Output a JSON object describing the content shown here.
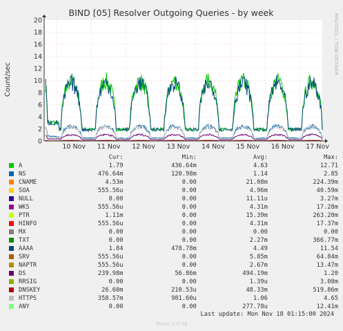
{
  "chart_data": {
    "type": "line",
    "title": "BIND [05] Resolver Outgoing Queries - by week",
    "ylabel": "Count/sec",
    "side_label": "RRDTOOL / TOBI OETIKER",
    "ylim": [
      0,
      20
    ],
    "y_ticks": [
      "0",
      "2",
      "4",
      "6",
      "8",
      "10",
      "12",
      "14",
      "16",
      "18",
      "20"
    ],
    "x_ticks": [
      "10 Nov",
      "11 Nov",
      "12 Nov",
      "13 Nov",
      "14 Nov",
      "15 Nov",
      "16 Nov",
      "17 Nov"
    ],
    "grid": true,
    "headers": [
      "Cur:",
      "Min:",
      "Avg:",
      "Max:"
    ],
    "series": [
      {
        "name": "A",
        "color": "#00cc00",
        "cur": "1.79",
        "min": "436.64m",
        "avg": "4.63",
        "max": "12.71"
      },
      {
        "name": "NS",
        "color": "#0066b3",
        "cur": "476.64m",
        "min": "120.98m",
        "avg": "1.14",
        "max": "2.85"
      },
      {
        "name": "CNAME",
        "color": "#ff8000",
        "cur": "4.53m",
        "min": "0.00",
        "avg": "21.08m",
        "max": "224.39m"
      },
      {
        "name": "SOA",
        "color": "#ffcc00",
        "cur": "555.56u",
        "min": "0.00",
        "avg": "4.96m",
        "max": "40.59m"
      },
      {
        "name": "NULL",
        "color": "#330099",
        "cur": "0.00",
        "min": "0.00",
        "avg": "11.11u",
        "max": "3.27m"
      },
      {
        "name": "WKS",
        "color": "#990099",
        "cur": "555.56u",
        "min": "0.00",
        "avg": "4.31m",
        "max": "17.28m"
      },
      {
        "name": "PTR",
        "color": "#ccff00",
        "cur": "1.11m",
        "min": "0.00",
        "avg": "15.39m",
        "max": "263.20m"
      },
      {
        "name": "HINFO",
        "color": "#ff0000",
        "cur": "555.56u",
        "min": "0.00",
        "avg": "4.31m",
        "max": "17.37m"
      },
      {
        "name": "MX",
        "color": "#808080",
        "cur": "0.00",
        "min": "0.00",
        "avg": "0.00",
        "max": "0.00"
      },
      {
        "name": "TXT",
        "color": "#008f00",
        "cur": "0.00",
        "min": "0.00",
        "avg": "2.27m",
        "max": "366.77m"
      },
      {
        "name": "AAAA",
        "color": "#00487d",
        "cur": "1.84",
        "min": "478.78m",
        "avg": "4.49",
        "max": "11.54"
      },
      {
        "name": "SRV",
        "color": "#b35a00",
        "cur": "555.56u",
        "min": "0.00",
        "avg": "5.85m",
        "max": "64.84m"
      },
      {
        "name": "NAPTR",
        "color": "#b38f00",
        "cur": "555.56u",
        "min": "0.00",
        "avg": "2.67m",
        "max": "13.47m"
      },
      {
        "name": "DS",
        "color": "#6b006b",
        "cur": "239.98m",
        "min": "56.86m",
        "avg": "494.19m",
        "max": "1.20"
      },
      {
        "name": "RRSIG",
        "color": "#8fb300",
        "cur": "0.00",
        "min": "0.00",
        "avg": "1.39u",
        "max": "3.08m"
      },
      {
        "name": "DNSKEY",
        "color": "#b30000",
        "cur": "26.60m",
        "min": "210.53u",
        "avg": "48.33m",
        "max": "519.86m"
      },
      {
        "name": "HTTPS",
        "color": "#bebebe",
        "cur": "358.57m",
        "min": "981.60u",
        "avg": "1.06",
        "max": "4.65"
      },
      {
        "name": "ANY",
        "color": "#80ff80",
        "cur": "0.00",
        "min": "0.00",
        "avg": "277.78u",
        "max": "12.41m"
      }
    ]
  },
  "footer": {
    "last_update": "Last update: Mon Nov 18 01:15:00 2024",
    "munin": "Munin 2.0.76"
  }
}
